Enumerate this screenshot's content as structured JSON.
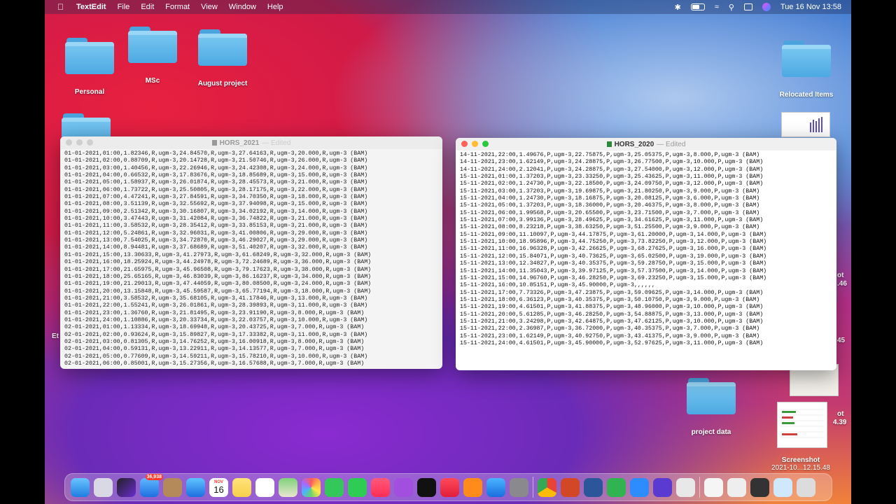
{
  "menubar": {
    "app": "TextEdit",
    "items": [
      "File",
      "Edit",
      "Format",
      "View",
      "Window",
      "Help"
    ],
    "clock": "Tue 16 Nov  13:58"
  },
  "desktop": {
    "folders": [
      {
        "label": "Personal"
      },
      {
        "label": "MSc"
      },
      {
        "label": "August project"
      },
      {
        "label": "Relocated Items"
      },
      {
        "label": "project data"
      }
    ],
    "screenshot_label": "Screenshot",
    "screenshot_sub": "2021-10...12.15.48",
    "partial_labels": [
      "ot",
      ".46",
      "45",
      "ot",
      "4.39",
      "Et"
    ]
  },
  "window_2021": {
    "title": "HORS_2021",
    "edited": "— Edited",
    "lines": [
      "01-01-2021,01:00,1.82346,R,ugm-3,24.84570,R,ugm-3,27.64163,R,ugm-3,20.000,R,ugm-3 (BAM)",
      "01-01-2021,02:00,0.88709,R,ugm-3,20.14728,R,ugm-3,21.50746,R,ugm-3,26.000,R,ugm-3 (BAM)",
      "01-01-2021,03:00,1.40456,R,ugm-3,22.26946,R,ugm-3,24.42308,R,ugm-3,24.000,R,ugm-3 (BAM)",
      "01-01-2021,04:00,0.66532,R,ugm-3,17.83676,R,ugm-3,18.85689,R,ugm-3,15.000,R,ugm-3 (BAM)",
      "01-01-2021,05:00,1.58937,R,ugm-3,26.01874,R,ugm-3,28.45573,R,ugm-3,21.000,R,ugm-3 (BAM)",
      "01-01-2021,06:00,1.73722,R,ugm-3,25.50805,R,ugm-3,28.17175,R,ugm-3,22.000,R,ugm-3 (BAM)",
      "01-01-2021,07:00,4.47241,R,ugm-3,27.84591,R,ugm-3,34.70350,R,ugm-3,18.000,R,ugm-3 (BAM)",
      "01-01-2021,08:00,3.51139,R,ugm-3,32.55692,R,ugm-3,37.94098,R,ugm-3,15.000,R,ugm-3 (BAM)",
      "01-01-2021,09:00,2.51342,R,ugm-3,30.16807,R,ugm-3,34.02192,R,ugm-3,14.000,R,ugm-3 (BAM)",
      "01-01-2021,10:00,3.47443,R,ugm-3,31.42084,R,ugm-3,36.74822,R,ugm-3,21.000,R,ugm-3 (BAM)",
      "01-01-2021,11:00,3.58532,R,ugm-3,28.35412,R,ugm-3,33.85153,R,ugm-3,21.000,R,ugm-3 (BAM)",
      "01-01-2021,12:00,5.24861,R,ugm-3,32.96031,R,ugm-3,41.00806,R,ugm-3,29.000,R,ugm-3 (BAM)",
      "01-01-2021,13:00,7.54025,R,ugm-3,34.72870,R,ugm-3,46.29027,R,ugm-3,29.000,R,ugm-3 (BAM)",
      "01-01-2021,14:00,8.94481,R,ugm-3,37.68689,R,ugm-3,51.40207,R,ugm-3,32.000,R,ugm-3 (BAM)",
      "01-01-2021,15:00,13.30633,R,ugm-3,41.27973,R,ugm-3,61.68249,R,ugm-3,32.000,R,ugm-3 (BAM)",
      "01-01-2021,16:00,18.25924,R,ugm-3,44.24978,R,ugm-3,72.24689,R,ugm-3,36.000,R,ugm-3 (BAM)",
      "01-01-2021,17:00,21.65975,R,ugm-3,45.96508,R,ugm-3,79.17623,R,ugm-3,38.000,R,ugm-3 (BAM)",
      "01-01-2021,18:00,25.65165,R,ugm-3,46.83039,R,ugm-3,86.16237,R,ugm-3,34.000,R,ugm-3 (BAM)",
      "01-01-2021,19:00,21.29013,R,ugm-3,47.44059,R,ugm-3,80.08500,R,ugm-3,24.000,R,ugm-3 (BAM)",
      "01-01-2021,20:00,13.15848,R,ugm-3,45.59587,R,ugm-3,65.77194,R,ugm-3,18.000,R,ugm-3 (BAM)",
      "01-01-2021,21:00,3.58532,R,ugm-3,35.68105,R,ugm-3,41.17846,R,ugm-3,13.000,R,ugm-3 (BAM)",
      "01-01-2021,22:00,1.55241,R,ugm-3,26.01861,R,ugm-3,28.39893,R,ugm-3,11.000,R,ugm-3 (BAM)",
      "01-01-2021,23:00,1.36760,R,ugm-3,21.81495,R,ugm-3,23.91190,R,ugm-3,8.000,R,ugm-3 (BAM)",
      "01-01-2021,24:00,1.10886,R,ugm-3,20.33734,R,ugm-3,22.03757,R,ugm-3,10.000,R,ugm-3 (BAM)",
      "02-01-2021,01:00,1.13334,R,ugm-3,18.69948,R,ugm-3,20.43725,R,ugm-3,7.000,R,ugm-3 (BAM)",
      "02-01-2021,02:00,0.93624,R,ugm-3,15.89827,R,ugm-3,17.33382,R,ugm-3,11.000,R,ugm-3 (BAM)",
      "02-01-2021,03:00,0.81305,R,ugm-3,14.76252,R,ugm-3,16.00918,R,ugm-3,8.000,R,ugm-3 (BAM)",
      "02-01-2021,04:00,0.59131,R,ugm-3,13.22911,R,ugm-3,14.13577,R,ugm-3,7.000,R,ugm-3 (BAM)",
      "02-01-2021,05:00,0.77609,R,ugm-3,14.59211,R,ugm-3,15.78210,R,ugm-3,10.000,R,ugm-3 (BAM)",
      "02-01-2021,06:00,0.85001,R,ugm-3,15.27356,R,ugm-3,16.57688,R,ugm-3,7.000,R,ugm-3 (BAM)"
    ]
  },
  "window_2020": {
    "title": "HORS_2020",
    "edited": "— Edited",
    "lines": [
      "14-11-2021,22:00,1.49676,P,ugm-3,22.75875,P,ugm-3,25.05375,P,ugm-3,8.000,P,ugm-3 (BAM)",
      "14-11-2021,23:00,1.62149,P,ugm-3,24.28875,P,ugm-3,26.77500,P,ugm-3,10.000,P,ugm-3 (BAM)",
      "14-11-2021,24:00,2.12041,P,ugm-3,24.28875,P,ugm-3,27.54000,P,ugm-3,12.000,P,ugm-3 (BAM)",
      "15-11-2021,01:00,1.37203,P,ugm-3,23.33250,P,ugm-3,25.43625,P,ugm-3,11.000,P,ugm-3 (BAM)",
      "15-11-2021,02:00,1.24730,P,ugm-3,22.18500,P,ugm-3,24.09750,P,ugm-3,12.000,P,ugm-3 (BAM)",
      "15-11-2021,03:00,1.37203,P,ugm-3,19.69875,P,ugm-3,21.80250,P,ugm-3,9.000,P,ugm-3 (BAM)",
      "15-11-2021,04:00,1.24730,P,ugm-3,18.16875,P,ugm-3,20.08125,P,ugm-3,6.000,P,ugm-3 (BAM)",
      "15-11-2021,05:00,1.37203,P,ugm-3,18.36000,P,ugm-3,20.46375,P,ugm-3,8.000,P,ugm-3 (BAM)",
      "15-11-2021,06:00,1.99568,P,ugm-3,20.65500,P,ugm-3,23.71500,P,ugm-3,7.000,P,ugm-3 (BAM)",
      "15-11-2021,07:00,3.99136,P,ugm-3,28.49625,P,ugm-3,34.61625,P,ugm-3,11.000,P,ugm-3 (BAM)",
      "15-11-2021,08:00,8.23218,P,ugm-3,38.63250,P,ugm-3,51.25500,P,ugm-3,9.000,P,ugm-3 (BAM)",
      "15-11-2021,09:00,11.10097,P,ugm-3,44.17875,P,ugm-3,61.20000,P,ugm-3,14.000,P,ugm-3 (BAM)",
      "15-11-2021,10:00,18.95896,P,ugm-3,44.75250,P,ugm-3,73.82250,P,ugm-3,12.000,P,ugm-3 (BAM)",
      "15-11-2021,11:00,16.96328,P,ugm-3,42.26625,P,ugm-3,68.27625,P,ugm-3,16.000,P,ugm-3 (BAM)",
      "15-11-2021,12:00,15.84071,P,ugm-3,40.73625,P,ugm-3,65.02500,P,ugm-3,19.000,P,ugm-3 (BAM)",
      "15-11-2021,13:00,12.34827,P,ugm-3,40.35375,P,ugm-3,59.28750,P,ugm-3,15.000,P,ugm-3 (BAM)",
      "15-11-2021,14:00,11.35043,P,ugm-3,39.97125,P,ugm-3,57.37500,P,ugm-3,14.000,P,ugm-3 (BAM)",
      "15-11-2021,15:00,14.96760,P,ugm-3,46.28250,P,ugm-3,69.23250,P,ugm-3,15.000,P,ugm-3 (BAM)",
      "15-11-2021,16:00,10.85151,P,ugm-3,45.90000,P,ugm-3,,,,,,",
      "15-11-2021,17:00,7.73326,P,ugm-3,47.23875,P,ugm-3,59.09625,P,ugm-3,14.000,P,ugm-3 (BAM)",
      "15-11-2021,18:00,6.36123,P,ugm-3,40.35375,P,ugm-3,50.10750,P,ugm-3,9.000,P,ugm-3 (BAM)",
      "15-11-2021,19:00,4.61501,P,ugm-3,41.88375,P,ugm-3,48.96000,P,ugm-3,10.000,P,ugm-3 (BAM)",
      "15-11-2021,20:00,5.61285,P,ugm-3,46.28250,P,ugm-3,54.88875,P,ugm-3,13.000,P,ugm-3 (BAM)",
      "15-11-2021,21:00,3.24298,P,ugm-3,42.64875,P,ugm-3,47.62125,P,ugm-3,10.000,P,ugm-3 (BAM)",
      "15-11-2021,22:00,2.36987,P,ugm-3,36.72000,P,ugm-3,40.35375,P,ugm-3,7.000,P,ugm-3 (BAM)",
      "15-11-2021,23:00,1.62149,P,ugm-3,40.92750,P,ugm-3,43.41375,P,ugm-3,9.000,P,ugm-3 (BAM)",
      "15-11-2021,24:00,4.61501,P,ugm-3,45.90000,P,ugm-3,52.97625,P,ugm-3,11.000,P,ugm-3 (BAM)"
    ]
  },
  "dock": {
    "mail_badge": "36,938",
    "calendar_month": "NOV",
    "calendar_day": "16",
    "apps": [
      "finder-icon",
      "launchpad-icon",
      "siri-icon",
      "mail-icon",
      "contacts-icon",
      "safari-icon",
      "calendar-icon",
      "notes-icon",
      "reminders-icon",
      "maps-icon",
      "photos-icon",
      "messages-icon",
      "facetime-icon",
      "music-icon",
      "podcasts-icon",
      "tv-icon",
      "news-icon",
      "books-icon",
      "app-store-icon",
      "system-preferences-icon",
      "chrome-icon",
      "powerpoint-icon",
      "word-icon",
      "numbers-icon",
      "zoom-icon",
      "imovie-icon",
      "textedit-icon",
      "document-icon",
      "spreadsheet-icon",
      "screenshot-icon",
      "folder-icon",
      "trash-icon"
    ]
  }
}
